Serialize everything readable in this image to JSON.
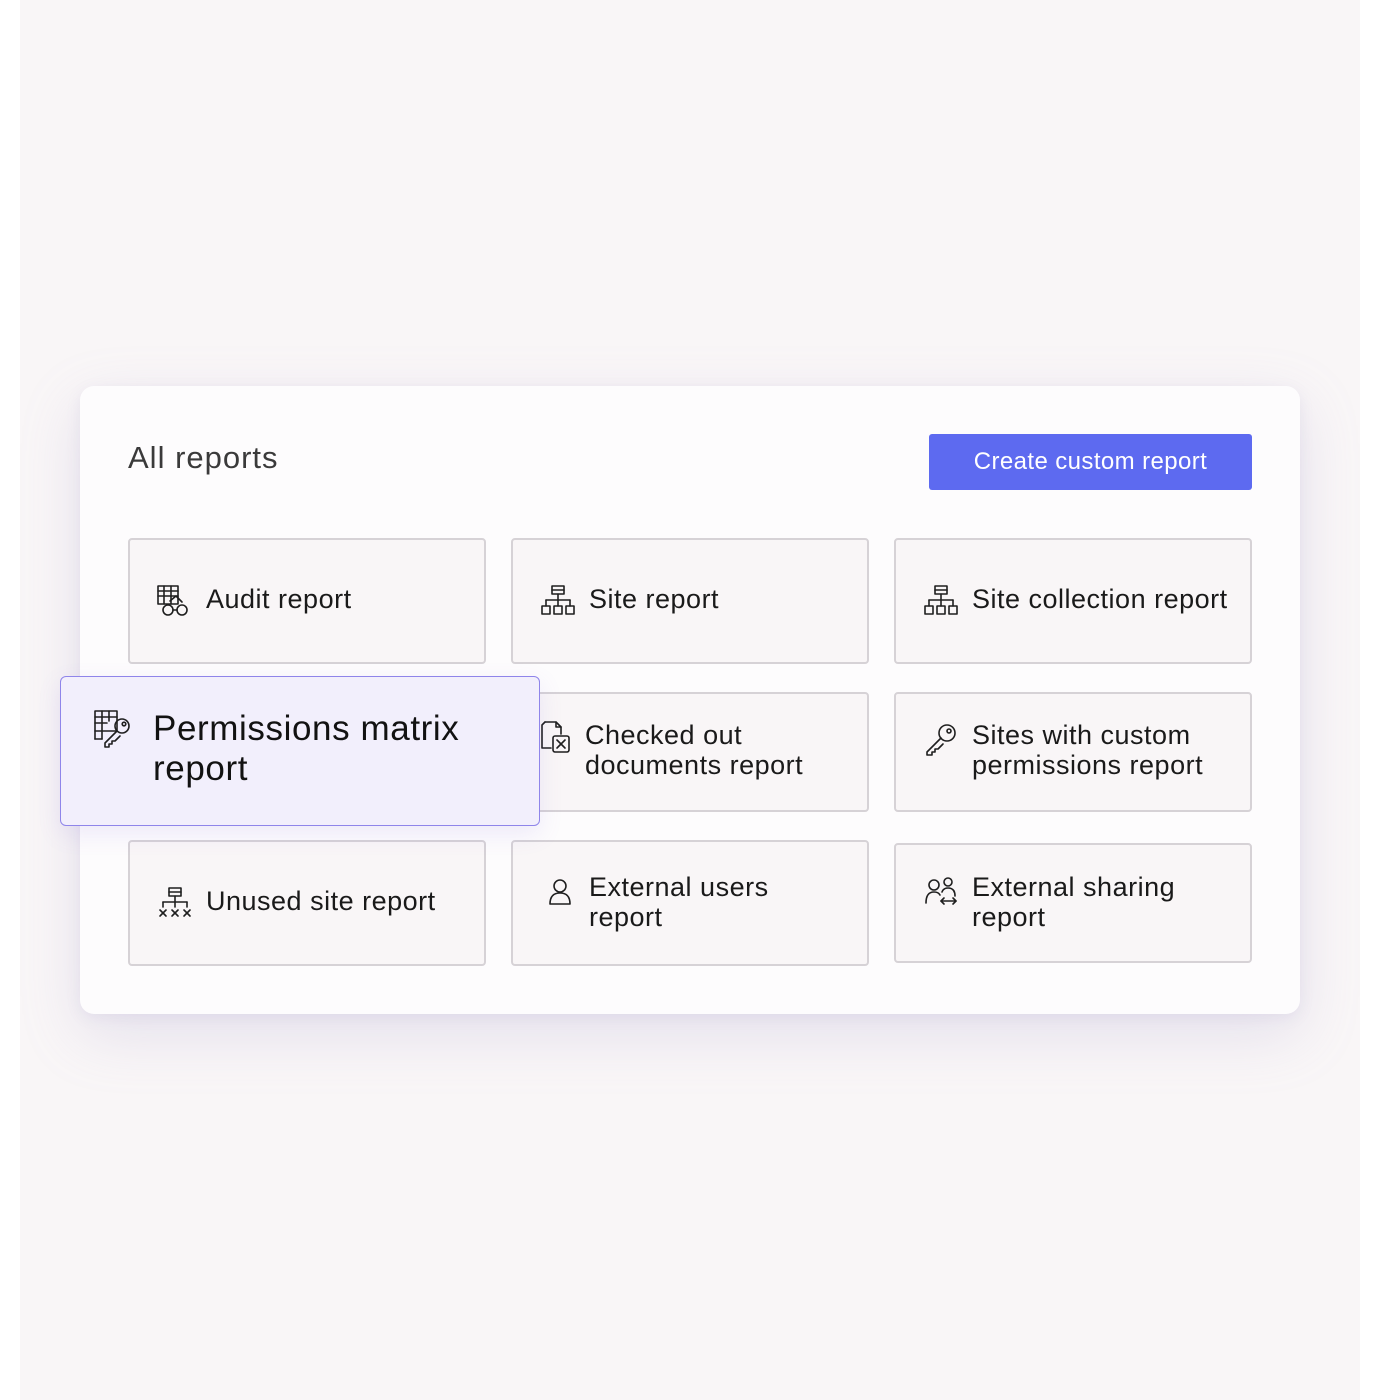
{
  "panel": {
    "title": "All reports",
    "create_button": "Create custom report"
  },
  "reports": {
    "audit": {
      "label": "Audit report",
      "icon": "audit-icon"
    },
    "site": {
      "label": "Site report",
      "icon": "site-hierarchy-icon"
    },
    "site_collection": {
      "label": "Site collection report",
      "icon": "site-hierarchy-icon"
    },
    "permissions_matrix": {
      "label_line1": "Permissions matrix",
      "label_line2": "report",
      "icon": "permissions-matrix-icon",
      "state": "highlighted"
    },
    "checked_out": {
      "label_line1": "Checked out",
      "label_line2": "documents report",
      "icon": "checked-out-document-icon"
    },
    "custom_permissions": {
      "label_line1": "Sites with custom",
      "label_line2": "permissions report",
      "icon": "key-icon"
    },
    "unused_site": {
      "label": "Unused site report",
      "icon": "unused-site-icon"
    },
    "external_users": {
      "label_line1": "External users",
      "label_line2": "report",
      "icon": "user-icon"
    },
    "external_sharing": {
      "label_line1": "External sharing",
      "label_line2": "report",
      "icon": "users-sharing-icon"
    }
  },
  "colors": {
    "accent": "#5d6af0",
    "highlight_bg": "#f2effc",
    "highlight_border": "#8f85ea",
    "page_bg": "#f9f6f7",
    "tile_border": "#d6d2d6"
  }
}
